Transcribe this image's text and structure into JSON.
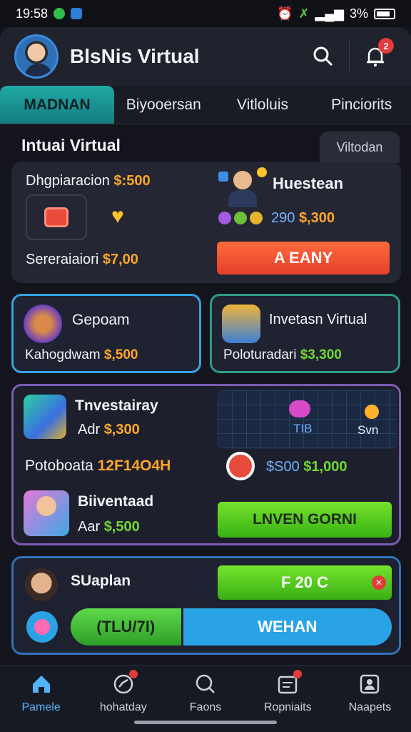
{
  "status": {
    "time": "19:58",
    "battery": "3%"
  },
  "header": {
    "title": "BlsNis Virtual",
    "notifications": "2"
  },
  "tabs": [
    {
      "label": "MADNAN",
      "active": true
    },
    {
      "label": "Biyooersan"
    },
    {
      "label": "Vitloluis"
    },
    {
      "label": "Pinciorits"
    }
  ],
  "section": {
    "title": "Intuai Virtual",
    "tab": "Viltodan"
  },
  "main_card": {
    "row1_label": "Dhgpiaracion",
    "row1_value": "$:500",
    "row2_label": "Sereraiaiori",
    "row2_value": "$7,00",
    "right_title": "Huestean",
    "right_value_a": "290",
    "right_value_b": "$,300",
    "button": "A EANY"
  },
  "mini_left": {
    "title": "Gepoam",
    "label": "Kahogdwam",
    "value": "$,500"
  },
  "mini_right": {
    "title": "Invetasn Virtual",
    "label": "Poloturadari",
    "value": "$3,300"
  },
  "invest_card": {
    "item1_title": "Tnvestairay",
    "item1_label": "Adr",
    "item1_value": "$,300",
    "middle_label": "Potoboata",
    "middle_value": "12F14O4H",
    "item2_title": "Biiventaad",
    "item2_label": "Aar",
    "item2_value": "$,500",
    "chart_label_a": "TIB",
    "chart_label_b": "Svn",
    "stat_a": "$S00",
    "stat_b": "$1,000",
    "button": "LNVEN GORNI"
  },
  "bottom_card": {
    "name": "SUaplan",
    "pill": "F 20 C",
    "progress_left": "(TLU/7I)",
    "progress_right": "WEHAN",
    "progress_fraction": 0.35
  },
  "nav": [
    {
      "label": "Pamele",
      "icon": "home-icon",
      "active": true
    },
    {
      "label": "hohatday",
      "icon": "chart-icon"
    },
    {
      "label": "Faons",
      "icon": "search-icon"
    },
    {
      "label": "Ropniaits",
      "icon": "calendar-icon"
    },
    {
      "label": "Naapets",
      "icon": "profile-icon"
    }
  ]
}
